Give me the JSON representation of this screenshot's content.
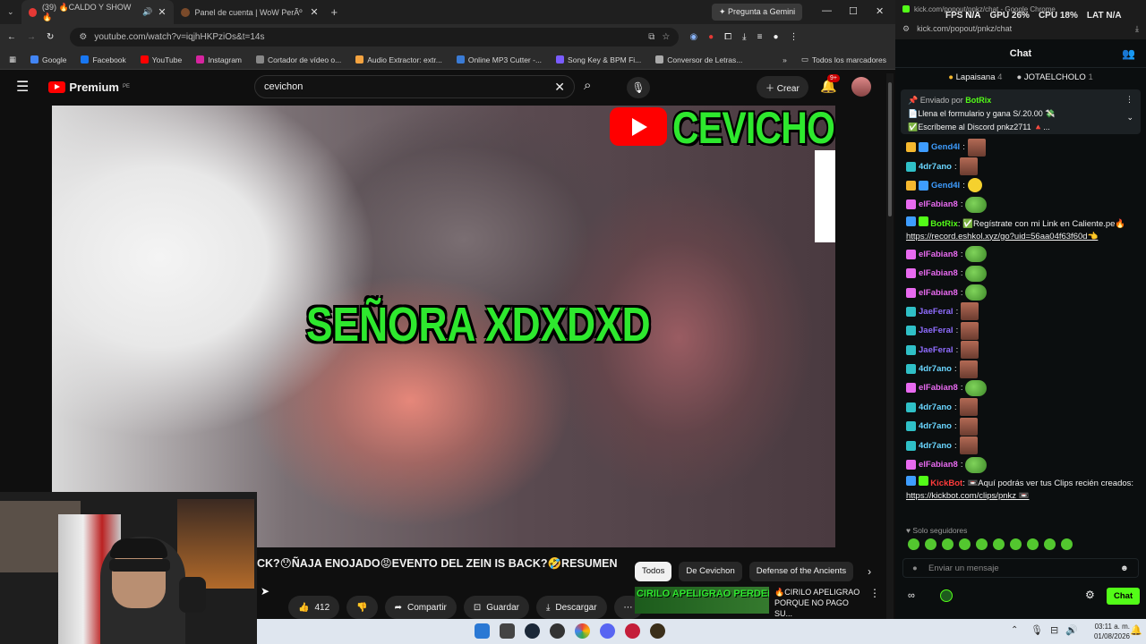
{
  "tabs": [
    {
      "title": "(39) 🔥CALDO Y SHOW 🔥",
      "active": true
    },
    {
      "title": "Panel de cuenta | WoW PerÃº",
      "active": false
    }
  ],
  "gemini": "Pregunta a Gemini",
  "url": "youtube.com/watch?v=iqjhHKPziOs&t=14s",
  "bookmarks": [
    "Google",
    "Facebook",
    "YouTube",
    "Instagram",
    "Cortador de vídeo o...",
    "Audio Extractor: extr...",
    "Online MP3 Cutter -...",
    "Song Key & BPM Fi...",
    "Conversor de Letras..."
  ],
  "bookmarks_all": "Todos los marcadores",
  "yt": {
    "logo": "Premium",
    "region": "PE",
    "search": "cevichon",
    "create": "Crear",
    "notif": "9+"
  },
  "video": {
    "channel_badge": "CEVICHON",
    "caption": "SEÑORA XDXDXD",
    "title": "CK?😯ÑAJA ENOJADO😡EVENTO DEL ZEIN IS BACK?🤣RESUMEN",
    "likes": "412",
    "share": "Compartir",
    "save": "Guardar",
    "download": "Descargar"
  },
  "chips": [
    "Todos",
    "De Cevichon",
    "Defense of the Ancients"
  ],
  "rec": {
    "thumb": "CIRILO APELIGRAO PERDERA",
    "title": "🔥CIRILO APELIGRAO PORQUE NO PAGO SU..."
  },
  "kick": {
    "window_title": "kick.com/popout/pnkz/chat - Google Chrome",
    "url": "kick.com/popout/pnkz/chat",
    "header": "Chat",
    "stats": {
      "fps_label": "FPS",
      "fps": "N/A",
      "gpu_label": "GPU",
      "gpu": "26%",
      "cpu_label": "CPU",
      "cpu": "18%",
      "lat_label": "LAT",
      "lat": "N/A"
    },
    "gifters": [
      {
        "name": "Lapaisana",
        "count": "4"
      },
      {
        "name": "JOTAELCHOLO",
        "count": "1"
      }
    ],
    "pinned": {
      "by": "Enviado por",
      "user": "BotRix",
      "line1": "📄Llena el formulario y gana S/.20.00 💸",
      "line2": "✅Escríbeme al Discord pnkz2711 🔺..."
    },
    "messages": [
      {
        "user": "Gend4l",
        "color": "#3e9dff",
        "emote": "face"
      },
      {
        "user": "4dr7ano",
        "color": "#6ad6ff",
        "emote": "face"
      },
      {
        "user": "Gend4l",
        "color": "#3e9dff",
        "emote": "face"
      },
      {
        "user": "elFabian8",
        "color": "#e86af0",
        "emote": "pepe"
      },
      {
        "user": "elFabian8",
        "color": "#e86af0",
        "emote": "pepe"
      },
      {
        "user": "elFabian8",
        "color": "#e86af0",
        "emote": "pepe"
      },
      {
        "user": "elFabian8",
        "color": "#e86af0",
        "emote": "pepe"
      },
      {
        "user": "JaeFeral",
        "color": "#8f6dff",
        "emote": "face"
      },
      {
        "user": "JaeFeral",
        "color": "#8f6dff",
        "emote": "face"
      },
      {
        "user": "JaeFeral",
        "color": "#8f6dff",
        "emote": "face"
      },
      {
        "user": "4dr7ano",
        "color": "#6ad6ff",
        "emote": "face"
      },
      {
        "user": "elFabian8",
        "color": "#e86af0",
        "emote": "pepe"
      },
      {
        "user": "4dr7ano",
        "color": "#6ad6ff",
        "emote": "face"
      },
      {
        "user": "4dr7ano",
        "color": "#6ad6ff",
        "emote": "face"
      },
      {
        "user": "4dr7ano",
        "color": "#6ad6ff",
        "emote": "face"
      },
      {
        "user": "elFabian8",
        "color": "#e86af0",
        "emote": "pepe"
      }
    ],
    "botrix_msg": {
      "user": "BotRix",
      "text": "✅Regístrate con mi Link en Caliente.pe🔥",
      "link": "https://record.eshkol.xyz/go?uid=56aa04f63f60d👈"
    },
    "kickbot_msg": {
      "user": "KickBot",
      "text": "📼Aquí podrás ver tus Clips recién creados:",
      "link": "https://kickbot.com/clips/pnkz 📼"
    },
    "solo": "Solo seguidores",
    "input_placeholder": "Enviar un mensaje",
    "chat_button": "Chat"
  },
  "clock": {
    "time": "03:11 a. m.",
    "date": "01/08/2026"
  }
}
